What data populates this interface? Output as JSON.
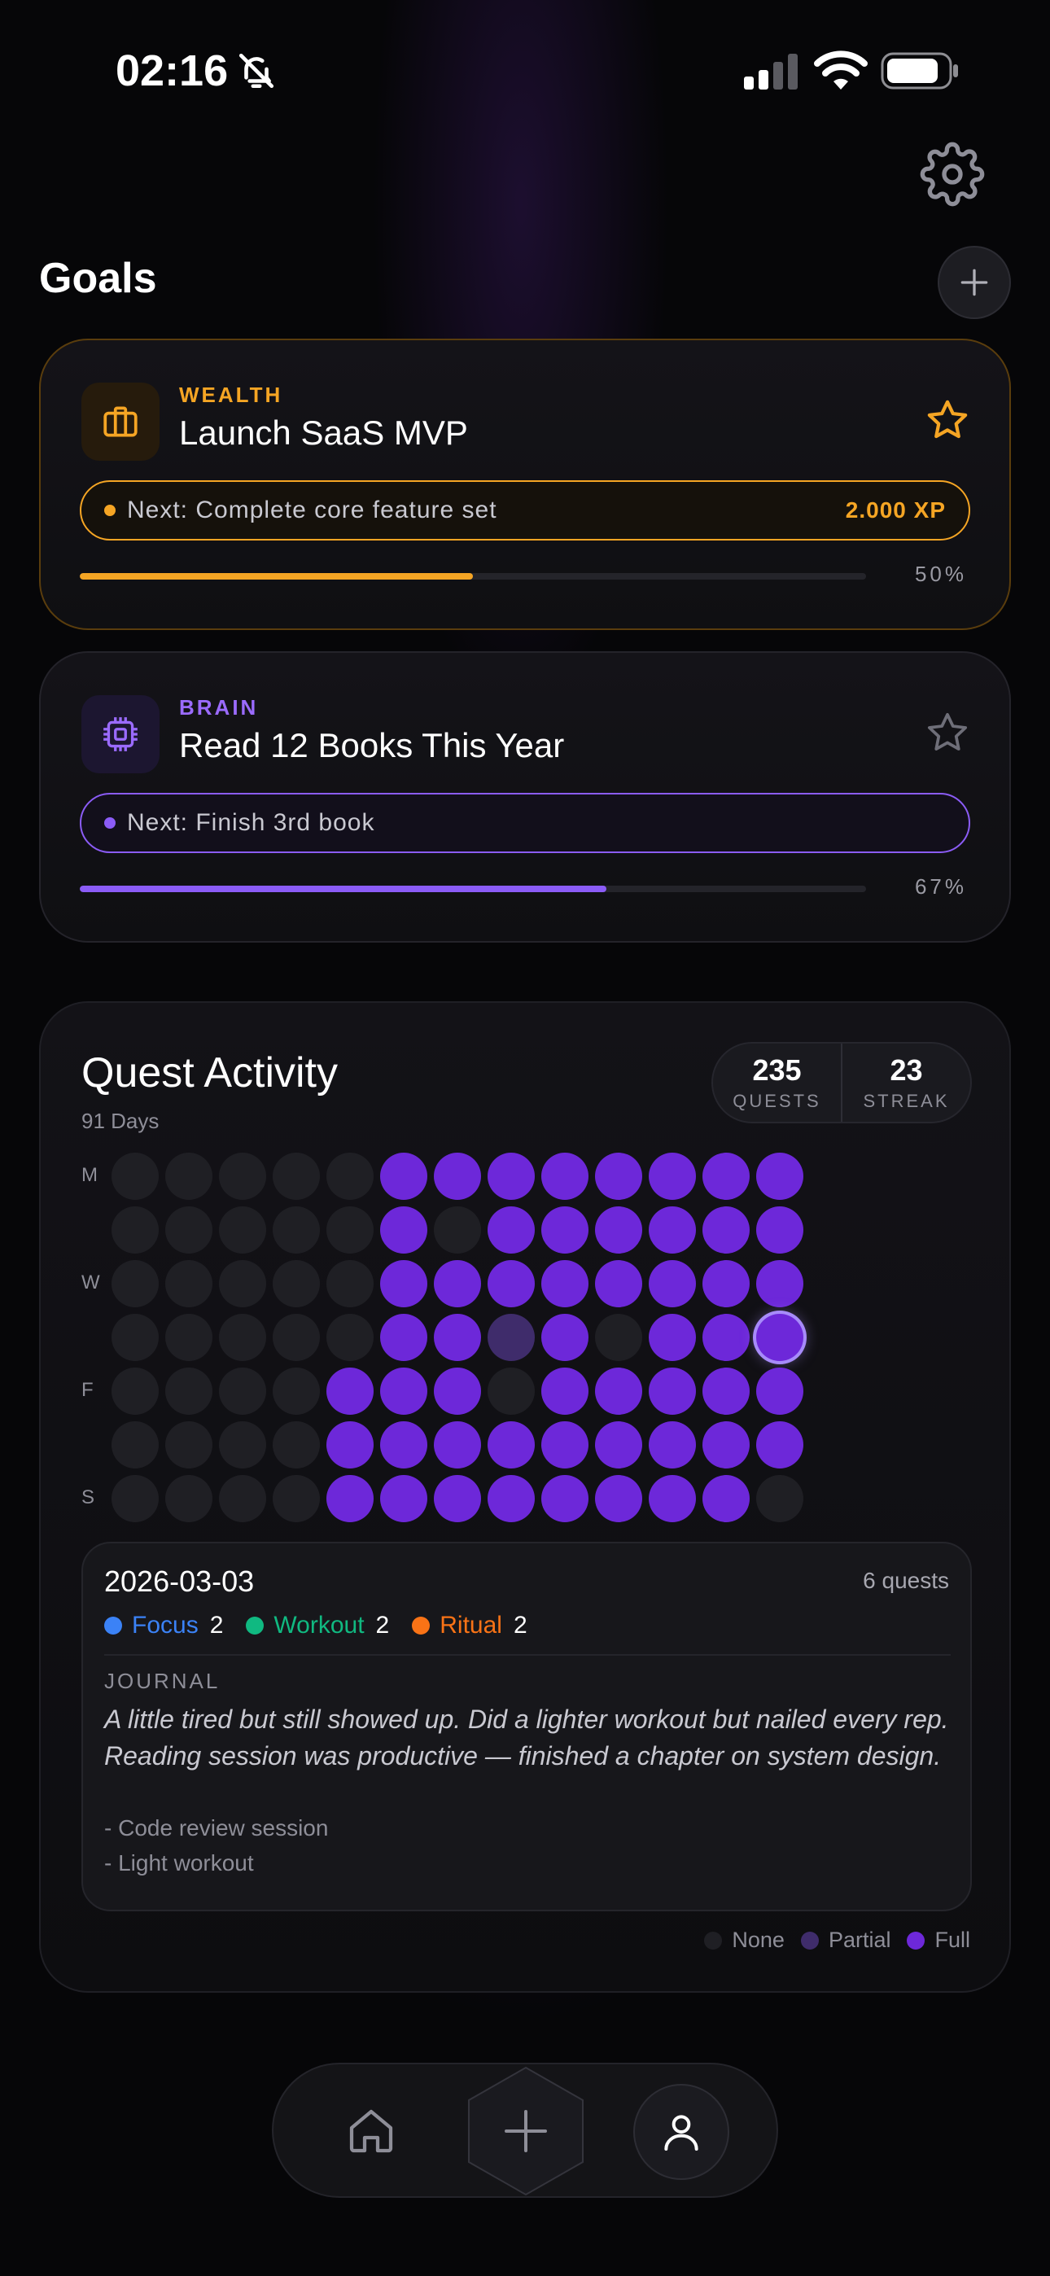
{
  "status": {
    "time": "02:16"
  },
  "goals": {
    "title": "Goals",
    "items": [
      {
        "category": "WEALTH",
        "name": "Launch SaaS MVP",
        "next": "Next: Complete core feature set",
        "xp": "2.000 XP",
        "progress": 0.5,
        "progress_label": "50%"
      },
      {
        "category": "BRAIN",
        "name": "Read 12 Books This Year",
        "next": "Next: Finish 3rd book",
        "progress": 0.67,
        "progress_label": "67%"
      }
    ]
  },
  "activity": {
    "title": "Quest Activity",
    "subtitle": "91 Days",
    "stats": [
      {
        "value": "235",
        "label": "QUESTS"
      },
      {
        "value": "23",
        "label": "STREAK"
      }
    ],
    "day_labels": [
      "M",
      "",
      "W",
      "",
      "F",
      "",
      "S"
    ],
    "grid_levels": [
      [
        0,
        0,
        0,
        0,
        0,
        2,
        2,
        2,
        2,
        2,
        2,
        2,
        2
      ],
      [
        0,
        0,
        0,
        0,
        0,
        2,
        0,
        2,
        2,
        2,
        2,
        2,
        2
      ],
      [
        0,
        0,
        0,
        0,
        0,
        2,
        2,
        2,
        2,
        2,
        2,
        2,
        2
      ],
      [
        0,
        0,
        0,
        0,
        0,
        2,
        2,
        1,
        2,
        0,
        2,
        2,
        2
      ],
      [
        0,
        0,
        0,
        0,
        2,
        2,
        2,
        0,
        2,
        2,
        2,
        2,
        2
      ],
      [
        0,
        0,
        0,
        0,
        2,
        2,
        2,
        2,
        2,
        2,
        2,
        2,
        2
      ],
      [
        0,
        0,
        0,
        0,
        2,
        2,
        2,
        2,
        2,
        2,
        2,
        2,
        0
      ]
    ],
    "selected_cell": [
      3,
      12
    ],
    "detail": {
      "date": "2026-03-03",
      "count": "6 quests",
      "tags": [
        {
          "name": "Focus",
          "count": "2",
          "color": "#3b82f6"
        },
        {
          "name": "Workout",
          "count": "2",
          "color": "#10b981"
        },
        {
          "name": "Ritual",
          "count": "2",
          "color": "#f97316"
        }
      ],
      "journal_label": "JOURNAL",
      "journal_text": "A little tired but still showed up. Did a lighter workout but nailed every rep. Reading session was productive — finished a chapter on system design.",
      "items": [
        "- Code review session",
        "- Light workout"
      ]
    },
    "legend": [
      {
        "label": "None",
        "color": "#1f1f24"
      },
      {
        "label": "Partial",
        "color": "#3f2c6b"
      },
      {
        "label": "Full",
        "color": "#6d28d9"
      }
    ]
  },
  "colors": {
    "wealth": "#f5a524",
    "brain": "#8b5cf6",
    "full": "#6d28d9"
  }
}
